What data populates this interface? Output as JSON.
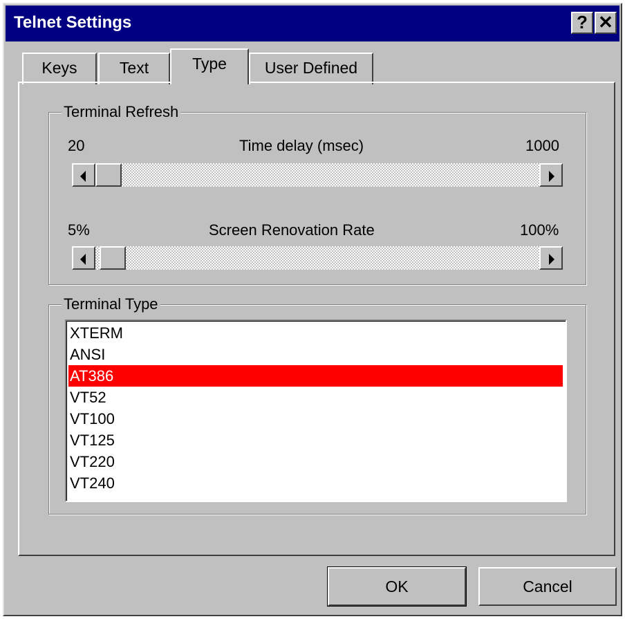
{
  "window": {
    "title": "Telnet Settings",
    "help_glyph": "?",
    "close_glyph": "✕"
  },
  "tabs": [
    {
      "label": "Keys",
      "active": false
    },
    {
      "label": "Text",
      "active": false
    },
    {
      "label": "Type",
      "active": true
    },
    {
      "label": "User Defined",
      "active": false
    }
  ],
  "terminal_refresh": {
    "title": "Terminal Refresh",
    "time_delay": {
      "label": "Time delay (msec)",
      "min_label": "20",
      "max_label": "1000",
      "value": 20
    },
    "renovation_rate": {
      "label": "Screen Renovation Rate",
      "min_label": "5%",
      "max_label": "100%",
      "value": "5%"
    }
  },
  "terminal_type": {
    "title": "Terminal Type",
    "items": [
      "XTERM",
      "ANSI",
      "AT386",
      "VT52",
      "VT100",
      "VT125",
      "VT220",
      "VT240"
    ],
    "selected": "AT386"
  },
  "buttons": {
    "ok": "OK",
    "cancel": "Cancel"
  },
  "colors": {
    "title_bar": "#000080",
    "face": "#c0c0c0",
    "selection": "#ff0000"
  }
}
